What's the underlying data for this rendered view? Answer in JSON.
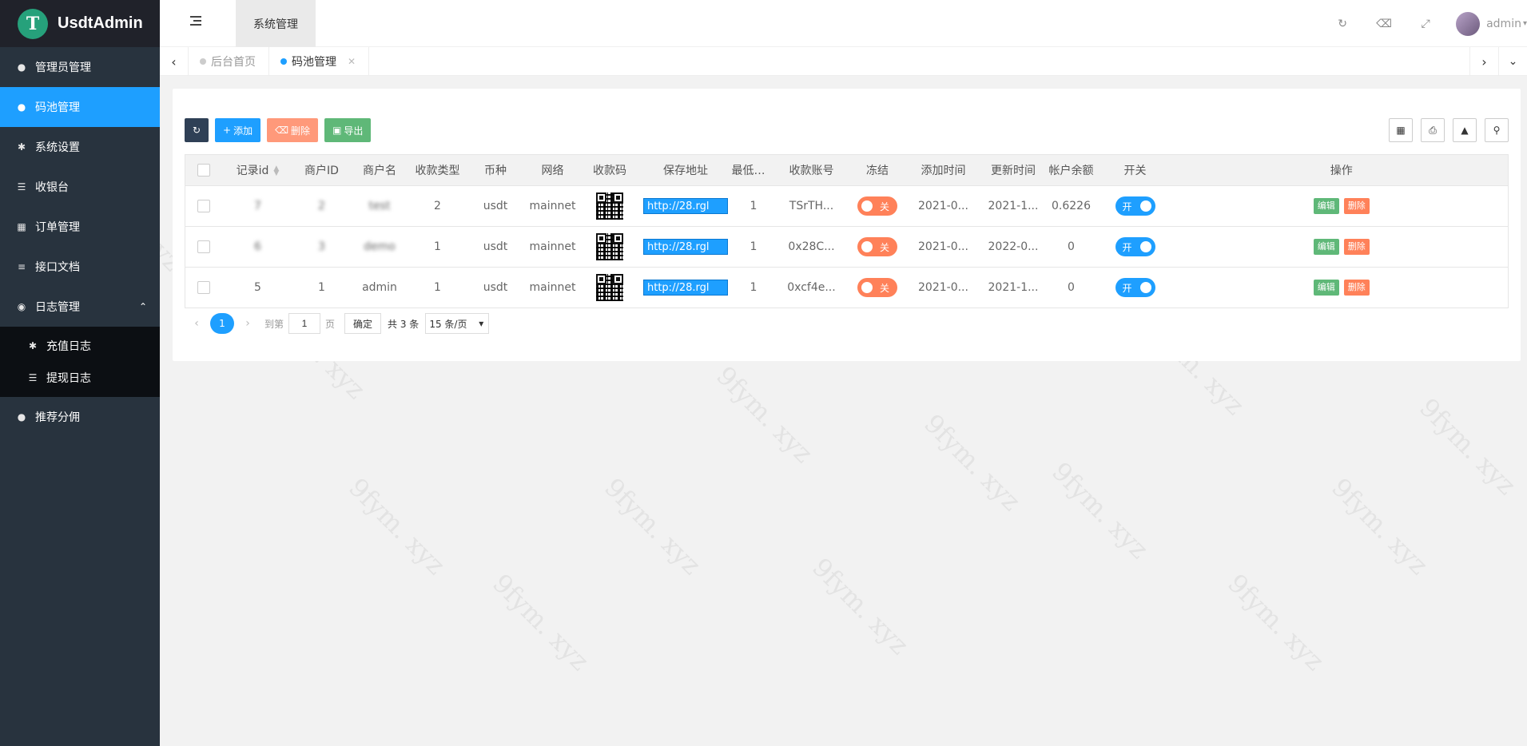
{
  "app": {
    "title": "UsdtAdmin",
    "logo_glyph": "T"
  },
  "sidebar": {
    "items": [
      {
        "label": "管理员管理",
        "icon": "user-icon"
      },
      {
        "label": "码池管理",
        "icon": "android-icon",
        "active": true
      },
      {
        "label": "系统设置",
        "icon": "gear-icon"
      },
      {
        "label": "收银台",
        "icon": "list-icon"
      },
      {
        "label": "订单管理",
        "icon": "calculator-icon"
      },
      {
        "label": "接口文档",
        "icon": "document-icon"
      },
      {
        "label": "日志管理",
        "icon": "log-icon",
        "expanded": true
      }
    ],
    "subitems": [
      {
        "label": "充值日志",
        "icon": "gear-icon"
      },
      {
        "label": "提现日志",
        "icon": "list-icon"
      }
    ],
    "after": [
      {
        "label": "推荐分佣",
        "icon": "android-icon"
      }
    ]
  },
  "header": {
    "top_tab": "系统管理",
    "user": "admin"
  },
  "tabs": [
    {
      "label": "后台首页"
    },
    {
      "label": "码池管理",
      "active": true
    }
  ],
  "toolbar": {
    "add": "添加",
    "delete": "删除",
    "export": "导出"
  },
  "table": {
    "columns": [
      "记录id",
      "商户ID",
      "商户名",
      "收款类型",
      "币种",
      "网络",
      "收款码",
      "保存地址",
      "最低收...",
      "收款账号",
      "冻结",
      "添加时间",
      "更新时间",
      "帐户余额",
      "开关",
      "操作"
    ],
    "rows": [
      {
        "id": "7",
        "merchant_id": "2",
        "merchant_name": "test",
        "type": "2",
        "currency": "usdt",
        "network": "mainnet",
        "address": "http://28.rgl",
        "min": "1",
        "account": "TSrTH...",
        "freeze": "关",
        "added": "2021-0...",
        "updated": "2021-1...",
        "balance": "0.6226",
        "switch": "开",
        "edit": "编辑",
        "remove": "删除",
        "blurred": true
      },
      {
        "id": "6",
        "merchant_id": "3",
        "merchant_name": "demo",
        "type": "1",
        "currency": "usdt",
        "network": "mainnet",
        "address": "http://28.rgl",
        "min": "1",
        "account": "0x28C...",
        "freeze": "关",
        "added": "2021-0...",
        "updated": "2022-0...",
        "balance": "0",
        "switch": "开",
        "edit": "编辑",
        "remove": "删除",
        "blurred": true
      },
      {
        "id": "5",
        "merchant_id": "1",
        "merchant_name": "admin",
        "type": "1",
        "currency": "usdt",
        "network": "mainnet",
        "address": "http://28.rgl",
        "min": "1",
        "account": "0xcf4e...",
        "freeze": "关",
        "added": "2021-0...",
        "updated": "2021-1...",
        "balance": "0",
        "switch": "开",
        "edit": "编辑",
        "remove": "删除",
        "blurred": false
      }
    ]
  },
  "pager": {
    "current": "1",
    "goto_label": "到第",
    "goto_value": "1",
    "page_label": "页",
    "confirm": "确定",
    "total": "共 3 条",
    "per_page": "15 条/页"
  },
  "watermark": "9fym. xyz"
}
